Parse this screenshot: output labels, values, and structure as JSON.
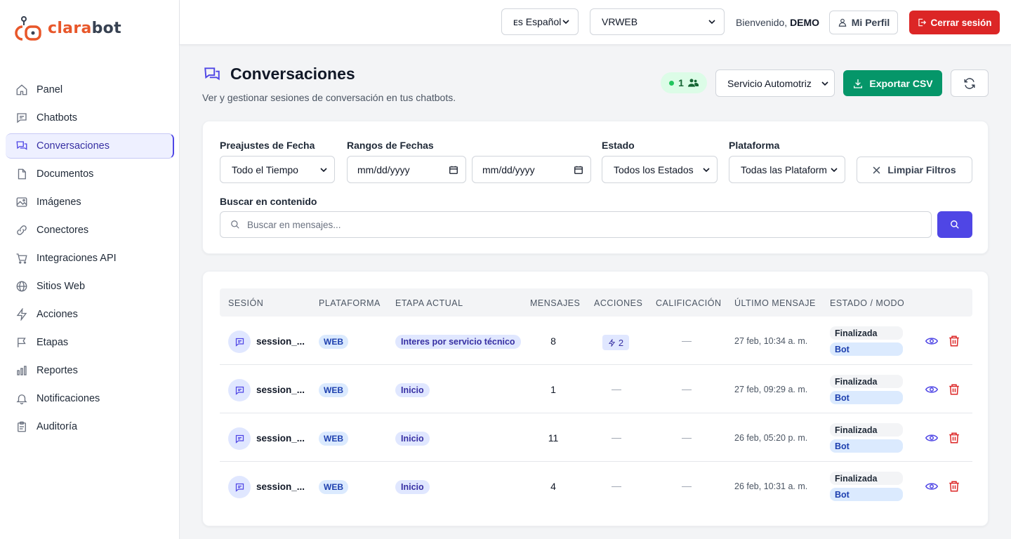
{
  "brand": {
    "part1": "clara",
    "part2": "bot",
    "accent": "#e8572a"
  },
  "sidebar": {
    "items": [
      {
        "label": "Panel",
        "icon": "home-icon"
      },
      {
        "label": "Chatbots",
        "icon": "chat-icon"
      },
      {
        "label": "Conversaciones",
        "icon": "conversations-icon",
        "active": true
      },
      {
        "label": "Documentos",
        "icon": "document-icon"
      },
      {
        "label": "Imágenes",
        "icon": "image-icon"
      },
      {
        "label": "Conectores",
        "icon": "link-icon"
      },
      {
        "label": "Integraciones API",
        "icon": "cart-icon"
      },
      {
        "label": "Sitios Web",
        "icon": "globe-icon"
      },
      {
        "label": "Acciones",
        "icon": "bolt-icon"
      },
      {
        "label": "Etapas",
        "icon": "flag-icon"
      },
      {
        "label": "Reportes",
        "icon": "bar-chart-icon"
      },
      {
        "label": "Notificaciones",
        "icon": "bell-icon"
      },
      {
        "label": "Auditoría",
        "icon": "clipboard-icon"
      }
    ]
  },
  "topbar": {
    "language": "ᴇs Español",
    "workspace": "VRWEB",
    "welcome_prefix": "Bienvenido,",
    "user": "DEMO",
    "profile_label": "Mi Perfil",
    "logout_label": "Cerrar sesión"
  },
  "header": {
    "title": "Conversaciones",
    "subtitle": "Ver y gestionar sesiones de conversación en tus chatbots.",
    "active_count": "1",
    "chatbot_select": "Servicio Automotriz",
    "export_label": "Exportar CSV"
  },
  "filters": {
    "date_preset_label": "Preajustes de Fecha",
    "date_preset_value": "Todo el Tiempo",
    "date_range_label": "Rangos de Fechas",
    "date_from": "mm/dd/yyyy",
    "date_to": "mm/dd/yyyy",
    "status_label": "Estado",
    "status_value": "Todos los Estados",
    "platform_label": "Plataforma",
    "platform_value": "Todas las Plataform",
    "clear_label": "Limpiar Filtros",
    "search_label": "Buscar en contenido",
    "search_placeholder": "Buscar en mensajes..."
  },
  "table": {
    "headers": [
      "SESIÓN",
      "PLATAFORMA",
      "ETAPA ACTUAL",
      "MENSAJES",
      "ACCIONES",
      "CALIFICACIÓN",
      "ÚLTIMO MENSAJE",
      "ESTADO / MODO"
    ],
    "rows": [
      {
        "session": "session_...",
        "platform": "WEB",
        "stage": "Interes por servicio técnico",
        "messages": "8",
        "actions": "2",
        "rating": "—",
        "last": "27 feb, 10:34 a. m.",
        "status": "Finalizada",
        "mode": "Bot"
      },
      {
        "session": "session_...",
        "platform": "WEB",
        "stage": "Inicio",
        "messages": "1",
        "actions": "—",
        "rating": "—",
        "last": "27 feb, 09:29 a. m.",
        "status": "Finalizada",
        "mode": "Bot"
      },
      {
        "session": "session_...",
        "platform": "WEB",
        "stage": "Inicio",
        "messages": "11",
        "actions": "—",
        "rating": "—",
        "last": "26 feb, 05:20 p. m.",
        "status": "Finalizada",
        "mode": "Bot"
      },
      {
        "session": "session_...",
        "platform": "WEB",
        "stage": "Inicio",
        "messages": "4",
        "actions": "—",
        "rating": "—",
        "last": "26 feb, 10:31 a. m.",
        "status": "Finalizada",
        "mode": "Bot"
      }
    ]
  }
}
